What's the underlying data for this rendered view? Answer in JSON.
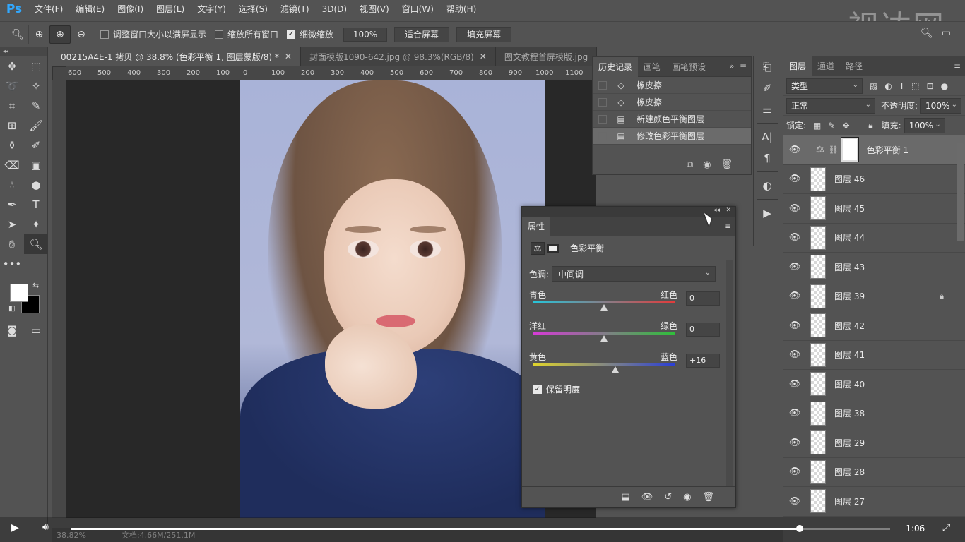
{
  "app": {
    "logo": "Ps",
    "watermark": "视达网"
  },
  "menu": [
    "文件(F)",
    "编辑(E)",
    "图像(I)",
    "图层(L)",
    "文字(Y)",
    "选择(S)",
    "滤镜(T)",
    "3D(D)",
    "视图(V)",
    "窗口(W)",
    "帮助(H)"
  ],
  "options": {
    "resize_windows": "调整窗口大小以满屏显示",
    "zoom_all": "缩放所有窗口",
    "scrubby_zoom": "细微缩放",
    "zoom_value": "100%",
    "fit_screen": "适合屏幕",
    "fill_screen": "填充屏幕"
  },
  "doc_tabs": [
    {
      "label": "00215A4E-1 拷贝 @ 38.8% (色彩平衡 1, 图层蒙版/8) *",
      "active": true
    },
    {
      "label": "封面模版1090-642.jpg @ 98.3%(RGB/8)",
      "active": false
    },
    {
      "label": "图文教程首屏模版.jpg",
      "active": false
    }
  ],
  "ruler_h": [
    "600",
    "500",
    "400",
    "300",
    "200",
    "100",
    "0",
    "100",
    "200",
    "300",
    "400",
    "500",
    "600",
    "700",
    "800",
    "900",
    "1000",
    "1100"
  ],
  "history": {
    "tabs": [
      "历史记录",
      "画笔",
      "画笔预设"
    ],
    "items": [
      {
        "label": "橡皮擦",
        "icon": "eraser-icon"
      },
      {
        "label": "橡皮擦",
        "icon": "eraser-icon"
      },
      {
        "label": "新建颜色平衡图层",
        "icon": "document-icon"
      },
      {
        "label": "修改色彩平衡图层",
        "icon": "document-icon"
      }
    ]
  },
  "properties": {
    "tab": "属性",
    "title": "色彩平衡",
    "tone_label": "色调:",
    "tone_value": "中间调",
    "sliders": [
      {
        "left": "青色",
        "right": "红色",
        "value": "0",
        "fraction": 0.5
      },
      {
        "left": "洋红",
        "right": "绿色",
        "value": "0",
        "fraction": 0.5
      },
      {
        "left": "黄色",
        "right": "蓝色",
        "value": "+16",
        "fraction": 0.58
      }
    ],
    "preserve_luminosity": "保留明度"
  },
  "layers": {
    "tabs": [
      "图层",
      "通道",
      "路径"
    ],
    "filter_kind": "类型",
    "blend_mode": "正常",
    "opacity_label": "不透明度:",
    "opacity_value": "100%",
    "lock_label": "锁定:",
    "fill_label": "填充:",
    "fill_value": "100%",
    "items": [
      {
        "name": "色彩平衡 1",
        "type": "adjustment",
        "selected": true
      },
      {
        "name": "图层 46"
      },
      {
        "name": "图层 45"
      },
      {
        "name": "图层 44"
      },
      {
        "name": "图层 43"
      },
      {
        "name": "图层 39",
        "locked": true
      },
      {
        "name": "图层 42"
      },
      {
        "name": "图层 41"
      },
      {
        "name": "图层 40"
      },
      {
        "name": "图层 38"
      },
      {
        "name": "图层 29"
      },
      {
        "name": "图层 28"
      },
      {
        "name": "图层 27"
      }
    ]
  },
  "status": {
    "zoom": "38.82%",
    "doc": "文档:4.66M/251.1M"
  },
  "video": {
    "time": "-1:06",
    "progress": 0.89
  },
  "colors": {
    "panel_bg": "#535353",
    "ps_blue": "#31a8ff"
  }
}
